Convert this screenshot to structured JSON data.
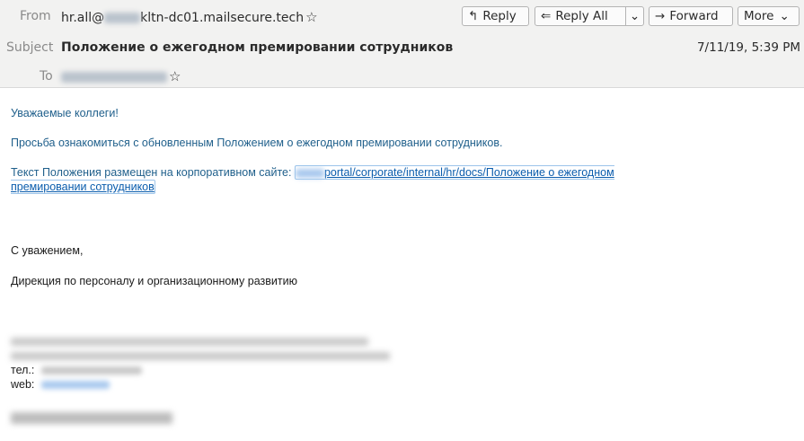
{
  "header": {
    "from_label": "From",
    "from_prefix": "hr.all@",
    "from_suffix": "kltn-dc01.mailsecure.tech",
    "subject_label": "Subject",
    "subject": "Положение о ежегодном премировании сотрудников",
    "to_label": "To",
    "date": "7/11/19, 5:39 PM"
  },
  "toolbar": {
    "reply": "Reply",
    "reply_all": "Reply All",
    "forward": "Forward",
    "more": "More"
  },
  "icons": {
    "star": "star-icon",
    "reply": "reply-icon",
    "reply_all": "reply-all-icon",
    "forward": "forward-icon",
    "dropdown": "chevron-down-icon"
  },
  "body": {
    "greeting": "Уважаемые коллеги!",
    "para1": "Просьба ознакомиться с обновленным Положением о ежегодном премировании сотрудников.",
    "para2_text": "Текст Положения размещен на корпоративном сайте: ",
    "link_line1": "portal/corporate/internal/hr/docs/Положение о ежегодном",
    "link_line2": "премировании сотрудников",
    "regards": "С уважением,",
    "department": "Дирекция по персоналу и организационному развитию",
    "tel_label": "тел.:",
    "web_label": "web:"
  },
  "colors": {
    "header_bg": "#f2f2f1",
    "body_blue": "#1f5f8b",
    "link": "#0b5dad"
  }
}
